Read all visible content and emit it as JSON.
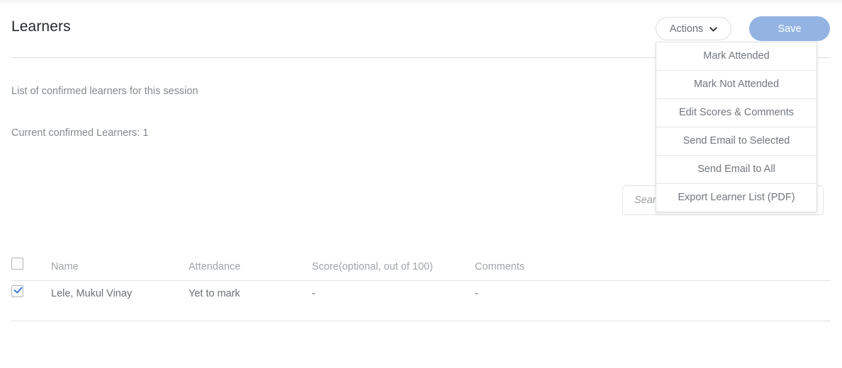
{
  "header": {
    "title": "Learners",
    "actions_button": {
      "label": "Actions",
      "icon": "chevron-down-icon"
    },
    "save_button": {
      "label": "Save",
      "color": "#93b4e2"
    }
  },
  "body": {
    "description": "List of confirmed learners for this session",
    "count_line": "Current confirmed Learners: 1"
  },
  "search": {
    "placeholder": "Search...",
    "value": ""
  },
  "dropdown": {
    "open": true,
    "items": [
      {
        "label": "Mark Attended"
      },
      {
        "label": "Mark Not Attended"
      },
      {
        "label": "Edit Scores & Comments"
      },
      {
        "label": "Send Email to Selected"
      },
      {
        "label": "Send Email to All"
      },
      {
        "label": "Export Learner List (PDF)"
      }
    ]
  },
  "table": {
    "select_all_checked": false,
    "columns": [
      {
        "key": "name",
        "label": "Name"
      },
      {
        "key": "attendance",
        "label": "Attendance"
      },
      {
        "key": "score",
        "label": "Score(optional, out of 100)"
      },
      {
        "key": "comments",
        "label": "Comments"
      }
    ],
    "rows": [
      {
        "selected": true,
        "name": "Lele, Mukul Vinay",
        "attendance": "Yet to mark",
        "score": "-",
        "comments": "-"
      }
    ]
  }
}
